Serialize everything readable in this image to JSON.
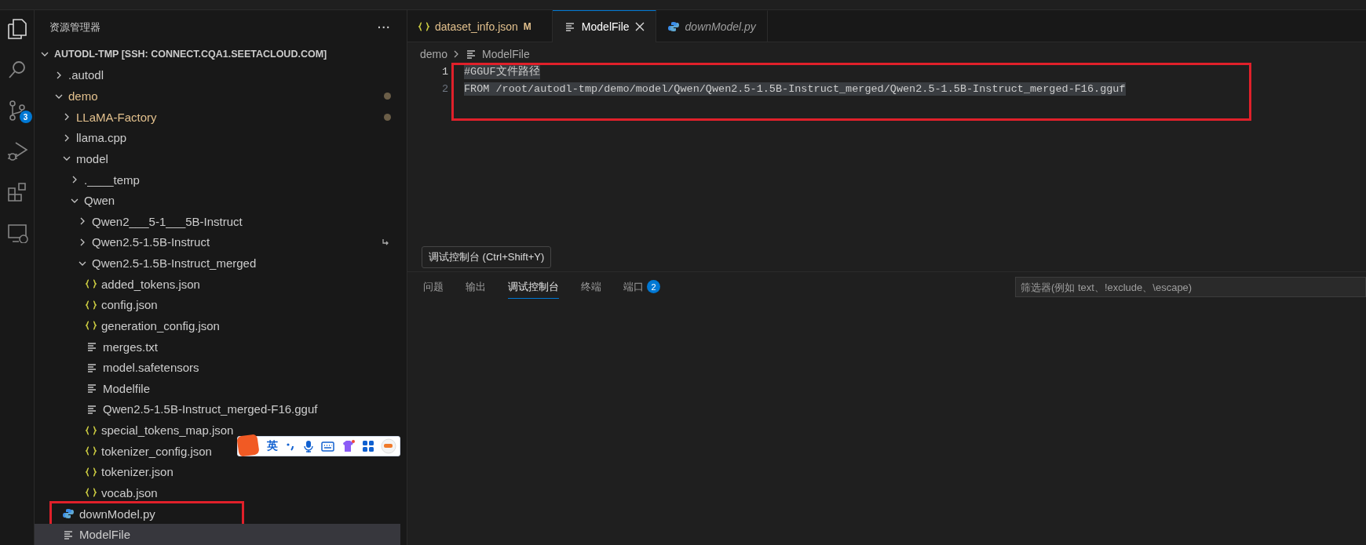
{
  "activity_bar": {
    "items": [
      {
        "kind": "files",
        "selected": true
      },
      {
        "kind": "search",
        "selected": false
      },
      {
        "kind": "source-control",
        "selected": false,
        "badge": "3"
      },
      {
        "kind": "run-debug",
        "selected": false
      },
      {
        "kind": "extensions",
        "selected": false
      },
      {
        "kind": "remote",
        "selected": false
      }
    ]
  },
  "explorer": {
    "title": "资源管理器",
    "more": "···",
    "tree": {
      "label": "AUTODL-TMP [SSH: CONNECT.CQA1.SEETACLOUD.COM]",
      "kind": "root",
      "expanded": true,
      "selected": false,
      "modified": false,
      "outlined": false,
      "children": [
        {
          "label": ".autodl",
          "kind": "folder",
          "expanded": false,
          "selected": false,
          "modified": false,
          "outlined": false
        },
        {
          "label": "demo",
          "kind": "folder",
          "expanded": true,
          "selected": false,
          "modified": true,
          "outlined": false,
          "children": [
            {
              "label": "LLaMA-Factory",
              "kind": "folder",
              "expanded": false,
              "selected": false,
              "modified": true,
              "outlined": false
            },
            {
              "label": "llama.cpp",
              "kind": "folder",
              "expanded": false,
              "selected": false,
              "modified": false,
              "outlined": false
            },
            {
              "label": "model",
              "kind": "folder",
              "expanded": true,
              "selected": false,
              "modified": false,
              "outlined": false,
              "children": [
                {
                  "label": ".____temp",
                  "kind": "folder",
                  "expanded": false,
                  "selected": false,
                  "modified": false,
                  "outlined": false
                },
                {
                  "label": "Qwen",
                  "kind": "folder",
                  "expanded": true,
                  "selected": false,
                  "modified": false,
                  "outlined": false,
                  "children": [
                    {
                      "label": "Qwen2___5-1___5B-Instruct",
                      "kind": "folder",
                      "expanded": false,
                      "selected": false,
                      "modified": false,
                      "outlined": false
                    },
                    {
                      "label": "Qwen2.5-1.5B-Instruct",
                      "kind": "folder-link",
                      "expanded": false,
                      "selected": false,
                      "modified": false,
                      "outlined": false
                    },
                    {
                      "label": "Qwen2.5-1.5B-Instruct_merged",
                      "kind": "folder",
                      "expanded": true,
                      "selected": false,
                      "modified": false,
                      "outlined": false,
                      "children": [
                        {
                          "label": "added_tokens.json",
                          "kind": "json",
                          "selected": false,
                          "modified": false,
                          "outlined": false
                        },
                        {
                          "label": "config.json",
                          "kind": "json",
                          "selected": false,
                          "modified": false,
                          "outlined": false
                        },
                        {
                          "label": "generation_config.json",
                          "kind": "json",
                          "selected": false,
                          "modified": false,
                          "outlined": false
                        },
                        {
                          "label": "merges.txt",
                          "kind": "text",
                          "selected": false,
                          "modified": false,
                          "outlined": false
                        },
                        {
                          "label": "model.safetensors",
                          "kind": "text",
                          "selected": false,
                          "modified": false,
                          "outlined": false
                        },
                        {
                          "label": "Modelfile",
                          "kind": "text",
                          "selected": false,
                          "modified": false,
                          "outlined": false
                        },
                        {
                          "label": "Qwen2.5-1.5B-Instruct_merged-F16.gguf",
                          "kind": "text",
                          "selected": false,
                          "modified": false,
                          "outlined": false
                        },
                        {
                          "label": "special_tokens_map.json",
                          "kind": "json",
                          "selected": false,
                          "modified": false,
                          "outlined": false
                        },
                        {
                          "label": "tokenizer_config.json",
                          "kind": "json",
                          "selected": false,
                          "modified": false,
                          "outlined": false
                        },
                        {
                          "label": "tokenizer.json",
                          "kind": "json",
                          "selected": false,
                          "modified": false,
                          "outlined": false
                        },
                        {
                          "label": "vocab.json",
                          "kind": "json",
                          "selected": false,
                          "modified": false,
                          "outlined": false
                        }
                      ]
                    }
                  ]
                }
              ]
            },
            {
              "label": "downModel.py",
              "kind": "python",
              "selected": false,
              "modified": false,
              "outlined": true
            },
            {
              "label": "ModelFile",
              "kind": "text",
              "selected": true,
              "modified": false,
              "outlined": false
            }
          ]
        }
      ]
    }
  },
  "editor": {
    "tabs": [
      {
        "label": "dataset_info.json",
        "kind": "json",
        "selected": false,
        "preview": false,
        "modified": true,
        "badge": "M"
      },
      {
        "label": "ModelFile",
        "kind": "text",
        "selected": true,
        "preview": false,
        "modified": false
      },
      {
        "label": "downModel.py",
        "kind": "python",
        "selected": false,
        "preview": true,
        "modified": false
      }
    ],
    "breadcrumb": [
      {
        "label": "demo",
        "kind": "folder"
      },
      {
        "label": "ModelFile",
        "kind": "text"
      }
    ],
    "outlined": true,
    "lines": [
      {
        "number": "1",
        "text": "#GGUF文件路径",
        "current": true,
        "selected": true
      },
      {
        "number": "2",
        "text": "FROM /root/autodl-tmp/demo/model/Qwen/Qwen2.5-1.5B-Instruct_merged/Qwen2.5-1.5B-Instruct_merged-F16.gguf",
        "current": false,
        "selected": true
      }
    ]
  },
  "panel": {
    "tooltip": "调试控制台 (Ctrl+Shift+Y)",
    "tabs": [
      {
        "label": "问题",
        "selected": false
      },
      {
        "label": "输出",
        "selected": false
      },
      {
        "label": "调试控制台",
        "selected": true
      },
      {
        "label": "终端",
        "selected": false
      },
      {
        "label": "端口",
        "selected": false,
        "badge": "2"
      }
    ],
    "filter": {
      "placeholder": "筛选器(例如 text、!exclude、\\escape)"
    }
  },
  "ime_toolbar": {
    "mode": "英"
  }
}
